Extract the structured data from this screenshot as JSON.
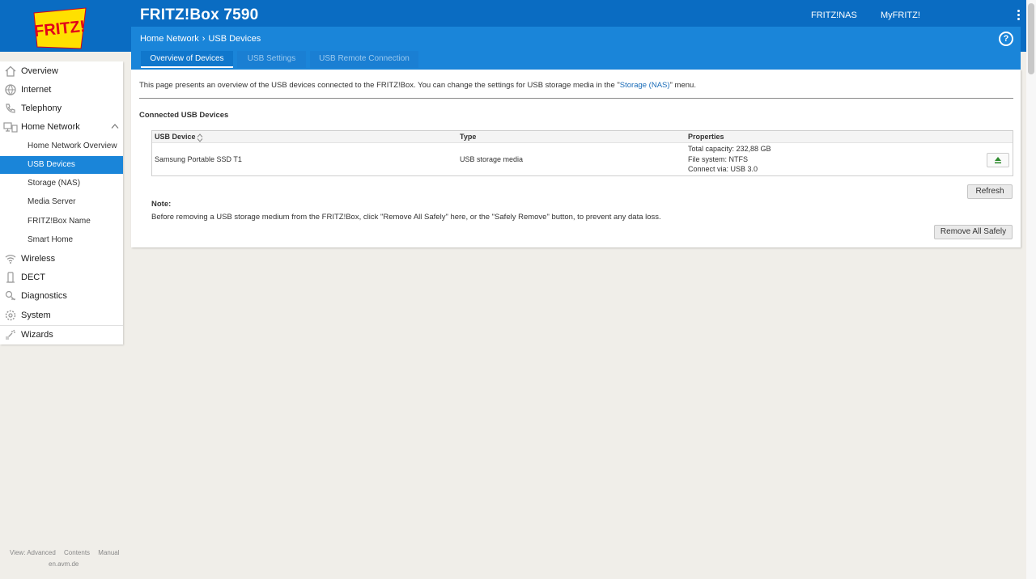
{
  "header": {
    "device_title": "FRITZ!Box 7590",
    "links": [
      "FRITZ!NAS",
      "MyFRITZ!"
    ],
    "logo_text": "FRITZ!"
  },
  "breadcrumb": {
    "parent": "Home Network",
    "current": "USB Devices"
  },
  "help_glyph": "?",
  "tabs": [
    {
      "label": "Overview of Devices",
      "active": true
    },
    {
      "label": "USB Settings",
      "active": false
    },
    {
      "label": "USB Remote Connection",
      "active": false
    }
  ],
  "sidebar": {
    "items": [
      {
        "label": "Overview",
        "icon": "home-icon"
      },
      {
        "label": "Internet",
        "icon": "globe-icon"
      },
      {
        "label": "Telephony",
        "icon": "phone-icon"
      },
      {
        "label": "Home Network",
        "icon": "network-icon",
        "expanded": true
      },
      {
        "label": "Wireless",
        "icon": "wifi-icon"
      },
      {
        "label": "DECT",
        "icon": "dect-phone-icon"
      },
      {
        "label": "Diagnostics",
        "icon": "diagnostics-icon"
      },
      {
        "label": "System",
        "icon": "system-gear-icon"
      },
      {
        "label": "Wizards",
        "icon": "wizard-icon"
      }
    ],
    "sub_items": [
      {
        "label": "Home Network Overview",
        "active": false
      },
      {
        "label": "USB Devices",
        "active": true
      },
      {
        "label": "Storage (NAS)",
        "active": false
      },
      {
        "label": "Media Server",
        "active": false
      },
      {
        "label": "FRITZ!Box Name",
        "active": false
      },
      {
        "label": "Smart Home",
        "active": false
      }
    ]
  },
  "content": {
    "intro_before": "This page presents an overview of the USB devices connected to the FRITZ!Box. You can change the settings for USB storage media in the \"",
    "intro_link": "Storage (NAS)",
    "intro_after": "\" menu.",
    "section_title": "Connected USB Devices",
    "table": {
      "columns": [
        "USB Device",
        "Type",
        "Properties"
      ],
      "rows": [
        {
          "device": "Samsung Portable SSD T1",
          "type": "USB storage media",
          "properties": [
            "Total capacity: 232,88 GB",
            "File system: NTFS",
            "Connect via: USB 3.0"
          ]
        }
      ]
    },
    "refresh_label": "Refresh",
    "note_title": "Note:",
    "note_text": "Before removing a USB storage medium from the FRITZ!Box, click \"Remove All Safely\" here, or the \"Safely Remove\" button, to prevent any data loss.",
    "remove_all_label": "Remove All Safely"
  },
  "footer": {
    "view_label": "View: Advanced",
    "contents_label": "Contents",
    "manual_label": "Manual",
    "site": "en.avm.de"
  },
  "colors": {
    "header_blue": "#0a6cc2",
    "bar_blue": "#1a85d9",
    "background": "#f0eee9",
    "logo_red": "#e2001a",
    "logo_yellow": "#ffe000"
  }
}
